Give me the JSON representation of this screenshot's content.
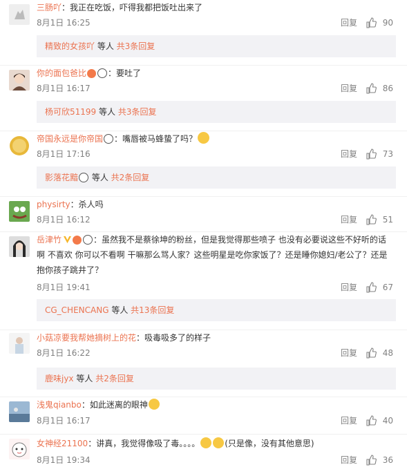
{
  "actions": {
    "reply_label": "回复"
  },
  "comments": [
    {
      "user": "三肠吖",
      "sep": "：",
      "text": "我正在吃饭，吓得我都把饭吐出来了",
      "date": "8月1日 16:25",
      "likes": "90",
      "replies": {
        "user": "精致的女孩吖",
        "mid": " 等人 ",
        "count": "共3条回复"
      }
    },
    {
      "user": "你的面包爸比",
      "sep": "：",
      "text": "要吐了",
      "date": "8月1日 16:17",
      "likes": "86",
      "replies": {
        "user": "杨可欣51199",
        "mid": " 等人 ",
        "count": "共3条回复"
      }
    },
    {
      "user": "帝国永远是你帝国",
      "sep": "：",
      "text": "嘴唇被马蜂蛰了吗？",
      "date": "8月1日 17:16",
      "likes": "73",
      "replies": {
        "user": "影落花黯",
        "mid": " 等人 ",
        "count": "共2条回复"
      }
    },
    {
      "user": "physirty",
      "sep": "：",
      "text": "杀人吗",
      "date": "8月1日 16:12",
      "likes": "51"
    },
    {
      "user": "岳津竹",
      "sep": "：",
      "text": "虽然我不是蔡徐坤的粉丝，但是我觉得那些喷子 也没有必要说这些不好听的话啊 不喜欢 你可以不看啊 干嘛那么骂人家？这些明星是吃你家饭了？还是睡你媳妇/老公了？还是抱你孩子跳井了？",
      "date": "8月1日 19:41",
      "likes": "67",
      "replies": {
        "user": "CG_CHENCANG",
        "mid": " 等人 ",
        "count": "共13条回复"
      }
    },
    {
      "user": "小菇凉要我帮她摘树上的花",
      "sep": "：",
      "text": "吸毒吸多了的样子",
      "date": "8月1日 16:22",
      "likes": "48",
      "replies": {
        "user": "鹿味jyx",
        "mid": " 等人 ",
        "count": "共2条回复"
      }
    },
    {
      "user": "浅鬼qianbo",
      "sep": "：",
      "text": "如此迷离的眼神",
      "date": "8月1日 16:17",
      "likes": "40"
    },
    {
      "user": "女神经21100",
      "sep": "：",
      "text": "讲真，我觉得像吸了毒。。。。",
      "text2": "(只是像，没有其他意思)",
      "date": "8月1日 19:34",
      "likes": "36"
    }
  ],
  "colors": {
    "username": "#eb7350",
    "meta": "#808080",
    "reply_bg": "#f2f2f5"
  }
}
